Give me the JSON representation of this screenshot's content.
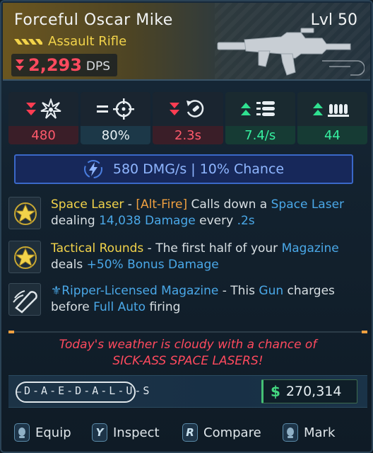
{
  "item": {
    "name": "Forceful Oscar Mike",
    "level": "Lvl 50",
    "type": "Assault Rifle",
    "dps_value": "2,293",
    "dps_unit": "DPS",
    "rarity_icon": "rarity-chevrons-icon",
    "dps_trend_icon": "double-down-arrow-icon",
    "weapon_art": "assault-rifle-silhouette"
  },
  "stats": [
    {
      "icon": "damage-burst-icon",
      "trend": "down",
      "value": "480",
      "tone": "bad"
    },
    {
      "icon": "accuracy-crosshair-icon",
      "trend": "equal",
      "value": "80%",
      "tone": "neutral"
    },
    {
      "icon": "reload-speed-icon",
      "trend": "down",
      "value": "2.3s",
      "tone": "bad"
    },
    {
      "icon": "fire-rate-bullets-icon",
      "trend": "up",
      "value": "7.4/s",
      "tone": "good"
    },
    {
      "icon": "magazine-size-icon",
      "trend": "up",
      "value": "44",
      "tone": "good"
    }
  ],
  "element": {
    "icon": "shock-lightning-icon",
    "text": "580 DMG/s | 10% Chance"
  },
  "perks": [
    {
      "icon": "star-badge-icon",
      "name": "Space Laser",
      "sep": " - ",
      "tag": "[Alt-Fire]",
      "t1": " Calls down a ",
      "k1": "Space Laser",
      "t2": " dealing ",
      "k2": "14,038 Damage",
      "t3": " every ",
      "k3": ".2s"
    },
    {
      "icon": "star-badge-icon",
      "name": "Tactical Rounds",
      "t1": " - The first half of your ",
      "k1": "Magazine",
      "t2": " deals ",
      "k2": "+50% Bonus Damage"
    },
    {
      "icon": "magazine-part-icon",
      "manufacturer_icon": "ripper-fleur-icon",
      "name": "Ripper-Licensed Magazine",
      "t1": " - This ",
      "k1": "Gun",
      "t2": " charges before ",
      "k2": "Full Auto",
      "t3": " firing"
    }
  ],
  "flavor": {
    "line1": "Today's weather is cloudy with a chance of",
    "line2": "SICK-ASS SPACE LASERS!"
  },
  "manufacturer": {
    "name": "D-A-E-D-A-L-U-S",
    "logo_icon": "daedalus-logo"
  },
  "price": {
    "icon": "dollar-icon",
    "symbol": "$",
    "value": "270,314"
  },
  "controls": [
    {
      "key": "",
      "icon": "left-stick-icon",
      "label": "Equip"
    },
    {
      "key": "Y",
      "label": "Inspect"
    },
    {
      "key": "R",
      "label": "Compare"
    },
    {
      "key": "",
      "icon": "right-stick-icon",
      "label": "Mark"
    }
  ],
  "colors": {
    "legendary_gold": "#f2d34a",
    "stat_down": "#ff5a6c",
    "stat_up": "#36f0a0",
    "keyword_blue": "#4aa8e8",
    "alt_fire_orange": "#f0a040",
    "shock_blue": "#8fb6ff"
  }
}
